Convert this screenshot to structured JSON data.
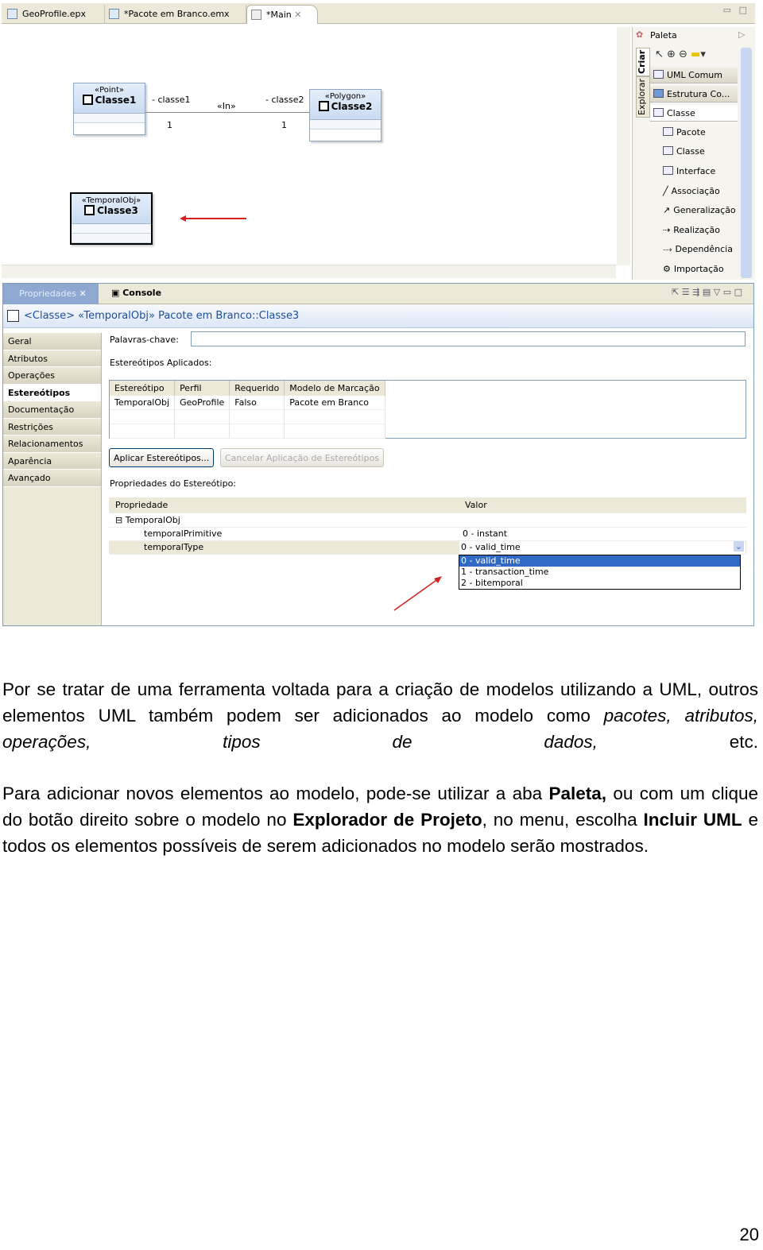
{
  "editor_tabs": [
    {
      "label": "GeoProfile.epx"
    },
    {
      "label": "*Pacote em Branco.emx"
    },
    {
      "label": "*Main"
    }
  ],
  "diagram": {
    "classe1": {
      "stereotype": "«Point»",
      "name": "Classe1"
    },
    "classe2": {
      "stereotype": "«Polygon»",
      "name": "Classe2"
    },
    "classe3": {
      "stereotype": "«TemporalObj»",
      "name": "Classe3"
    },
    "assoc": {
      "role1": "- classe1",
      "role2": "- classe2",
      "name": "«In»",
      "mult1": "1",
      "mult2": "1"
    },
    "arrow_color": "#d42020"
  },
  "palette": {
    "title": "Paleta",
    "side_tabs": [
      "Criar",
      "Explorar"
    ],
    "drawers": [
      "UML Comum",
      "Estrutura Co...",
      "Classe"
    ],
    "items": [
      "Pacote",
      "Classe",
      "Interface",
      "Associação",
      "Generalização",
      "Realização",
      "Dependência",
      "Importação"
    ]
  },
  "properties": {
    "tabs": [
      "Propriedades",
      "Console"
    ],
    "title": "<Classe> «TemporalObj» Pacote em Branco::Classe3",
    "sidebar": [
      "Geral",
      "Atributos",
      "Operações",
      "Estereótipos",
      "Documentação",
      "Restrições",
      "Relacionamentos",
      "Aparência",
      "Avançado"
    ],
    "selected": "Estereótipos",
    "keywords_label": "Palavras-chave:",
    "keywords_value": "",
    "applied_label": "Estereótipos Aplicados:",
    "applied_columns": [
      "Estereótipo",
      "Perfil",
      "Requerido",
      "Modelo de Marcação"
    ],
    "applied_rows": [
      [
        "TemporalObj",
        "GeoProfile",
        "Falso",
        "Pacote em Branco"
      ]
    ],
    "apply_button": "Aplicar Estereótipos...",
    "cancel_button": "Cancelar Aplicação de Estereótipos",
    "stereo_props_label": "Propriedades do Estereótipo:",
    "prop_columns": [
      "Propriedade",
      "Valor"
    ],
    "group": "TemporalObj",
    "prop_rows": [
      {
        "name": "temporalPrimitive",
        "value": "0 - instant"
      },
      {
        "name": "temporalType",
        "value": "0 - valid_time"
      }
    ],
    "dropdown_options": [
      "0 - valid_time",
      "1 - transaction_time",
      "2 - bitemporal"
    ],
    "dropdown_selected": "0 - valid_time",
    "highlight_color": "#316ac5"
  },
  "text": {
    "p1": {
      "a": "Por se tratar de uma ferramenta voltada para a criação de modelos utilizando a UML, outros elementos UML também podem ser adicionados ao modelo como ",
      "i1": "pacotes, atributos, operações, tipos de dados,",
      "b": " etc."
    },
    "p2": {
      "a": "Para adicionar novos elementos ao modelo, pode-se utilizar a aba ",
      "b1": "Paleta,",
      "c": " ou com um clique do botão direito sobre o modelo no ",
      "b2": "Explorador de Projeto",
      "d": ", no menu, escolha ",
      "b3": "Incluir UML",
      "e": " e todos os elementos possíveis de serem adicionados no modelo serão mostrados."
    },
    "page_number": "20"
  }
}
